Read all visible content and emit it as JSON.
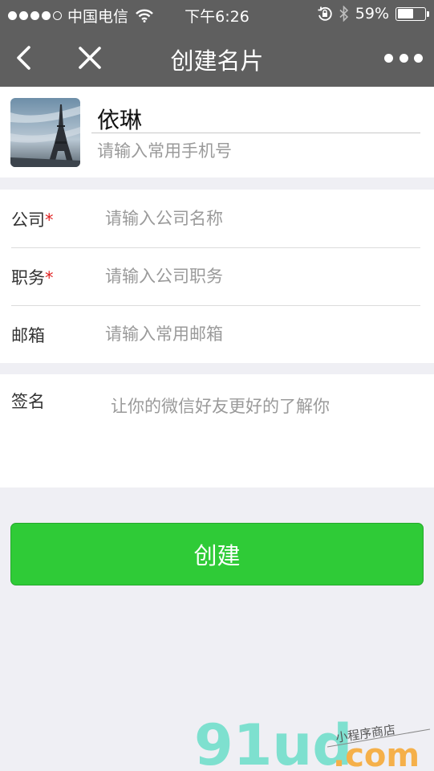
{
  "status_bar": {
    "carrier": "中国电信",
    "time": "下午6:26",
    "battery": "59%",
    "battery_level": 0.59
  },
  "nav": {
    "title": "创建名片"
  },
  "profile": {
    "name": "依琳",
    "phone_placeholder": "请输入常用手机号"
  },
  "form": {
    "company": {
      "label": "公司",
      "required_mark": "*",
      "placeholder": "请输入公司名称"
    },
    "position": {
      "label": "职务",
      "required_mark": "*",
      "placeholder": "请输入公司职务"
    },
    "email": {
      "label": "邮箱",
      "placeholder": "请输入常用邮箱"
    }
  },
  "signature": {
    "label": "签名",
    "placeholder": "让你的微信好友更好的了解你"
  },
  "create_button": {
    "label": "创建"
  },
  "watermark": {
    "logo": "91ud",
    "domain": ".com",
    "tagline": "小程序商店"
  },
  "colors": {
    "header_bg": "#5f5f5f",
    "button_green": "#2fcb37",
    "required_red": "#e02020",
    "page_bg": "#efeff4"
  }
}
